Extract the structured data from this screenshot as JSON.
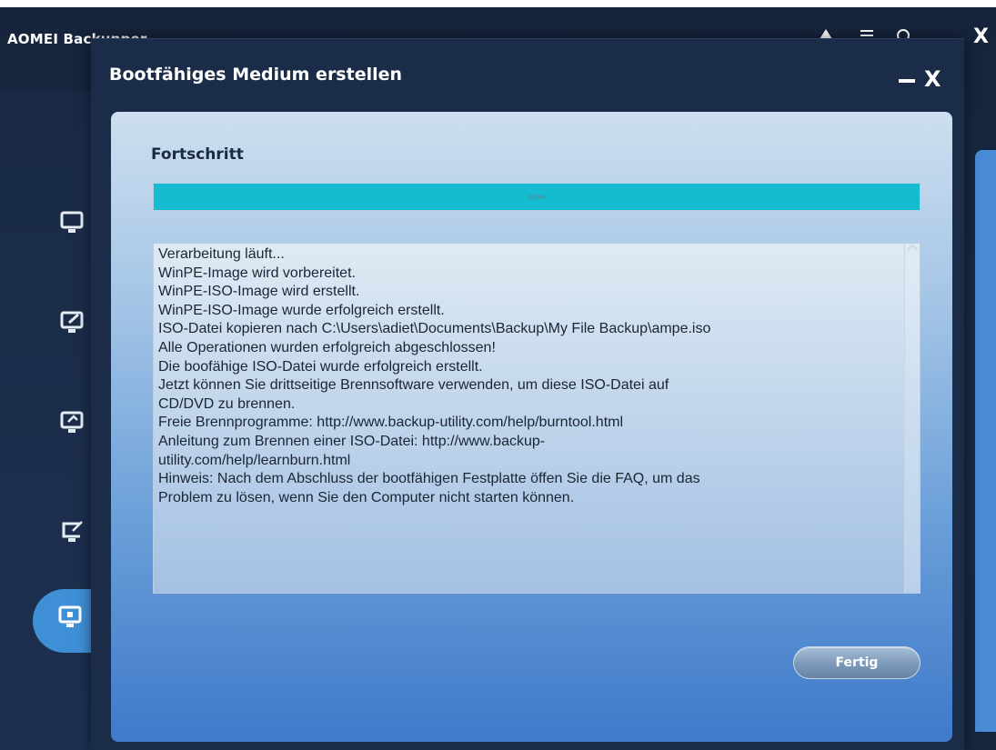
{
  "app": {
    "title": "AOMEI Backupper",
    "close_label": "X"
  },
  "dialog": {
    "title": "Bootfähiges Medium erstellen",
    "close_label": "X"
  },
  "progress": {
    "heading": "Fortschritt",
    "percent": 100,
    "percent_label": "100%"
  },
  "log": {
    "lines": [
      "Verarbeitung läuft...",
      "WinPE-Image wird vorbereitet.",
      "WinPE-ISO-Image wird erstellt.",
      "WinPE-ISO-Image wurde erfolgreich erstellt.",
      "ISO-Datei kopieren nach C:\\Users\\adiet\\Documents\\Backup\\My File Backup\\ampe.iso",
      "Alle Operationen wurden erfolgreich abgeschlossen!",
      "Die boofähige ISO-Datei wurde erfolgreich erstellt.",
      "Jetzt können Sie drittseitige Brennsoftware verwenden, um diese ISO-Datei auf",
      "CD/DVD zu brennen.",
      "Freie Brennprogramme: http://www.backup-utility.com/help/burntool.html",
      "Anleitung zum Brennen einer ISO-Datei: http://www.backup-",
      "utility.com/help/learnburn.html",
      "Hinweis: Nach dem Abschluss der bootfähigen Festplatte öffen Sie die FAQ, um das",
      "Problem zu lösen, wenn Sie den Computer nicht starten können."
    ]
  },
  "buttons": {
    "finish_label": "Fertig"
  },
  "sidebar": {
    "icons": [
      "home-icon",
      "backup-icon",
      "restore-icon",
      "clone-icon",
      "tools-icon"
    ],
    "active_index": 4
  },
  "colors": {
    "progress_fill": "#15bcd0",
    "sidebar_active": "#3e8fd6",
    "window_bg": "#1a2a45"
  }
}
